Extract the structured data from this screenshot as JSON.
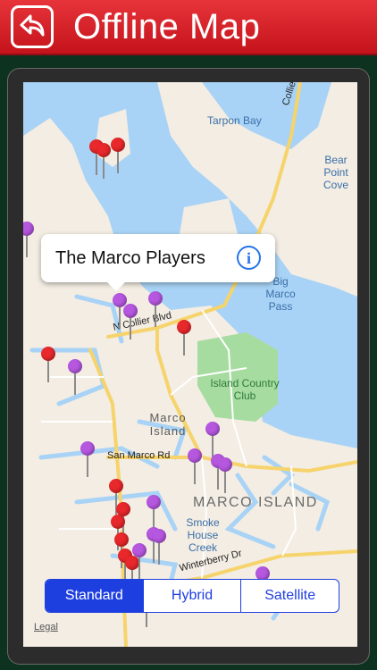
{
  "header": {
    "title": "Offline Map",
    "back_icon": "back-arrow-icon",
    "colors": {
      "bar": "#d4212a",
      "text": "#ffffff"
    }
  },
  "map": {
    "water_labels": [
      "Tarpon Bay",
      "Bear Point Cove",
      "Big Marco Pass"
    ],
    "road_labels": [
      "Collier B",
      "N Collier Blvd",
      "San Marco Rd",
      "Winterberry Dr"
    ],
    "area_labels": [
      "Marco Island",
      "MARCO ISLAND"
    ],
    "park_label": "Island Country Club",
    "legal": "Legal",
    "pin_colors": {
      "red": "#e8282b",
      "purple": "#b657e0"
    }
  },
  "callout": {
    "title": "The Marco Players",
    "info_icon": "info-icon"
  },
  "map_type": {
    "options": [
      "Standard",
      "Hybrid",
      "Satellite"
    ],
    "selected": "Standard",
    "accent": "#1e3fe0"
  }
}
